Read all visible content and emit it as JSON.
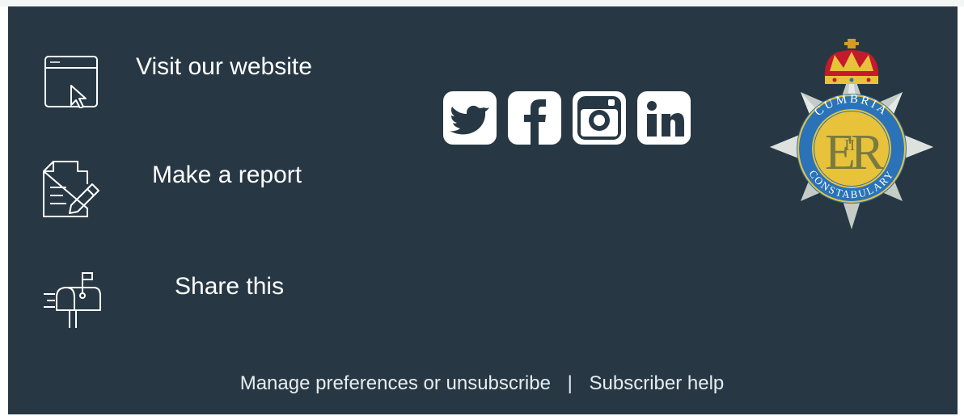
{
  "links": [
    {
      "label": "Visit our website",
      "icon": "browser-cursor-icon"
    },
    {
      "label": "Make a report",
      "icon": "document-edit-icon"
    },
    {
      "label": "Share this",
      "icon": "mailbox-icon"
    }
  ],
  "social": [
    {
      "icon": "twitter-icon"
    },
    {
      "icon": "facebook-icon"
    },
    {
      "icon": "instagram-icon"
    },
    {
      "icon": "linkedin-icon"
    }
  ],
  "footer": {
    "manage": "Manage preferences or unsubscribe",
    "separator": "|",
    "help": "Subscriber help"
  },
  "badge": {
    "top_text": "CUMBRIA",
    "bottom_text": "CONSTABULARY",
    "monogram_e": "E",
    "monogram_ii": "II",
    "monogram_r": "R"
  },
  "colors": {
    "background": "#273844",
    "text": "#ffffff",
    "badge_ring": "#2a73b8",
    "badge_gold": "#e7c23a"
  }
}
